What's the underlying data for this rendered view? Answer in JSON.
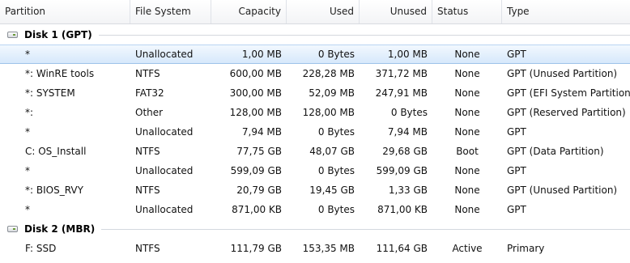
{
  "columns": {
    "partition": "Partition",
    "file_system": "File System",
    "capacity": "Capacity",
    "used": "Used",
    "unused": "Unused",
    "status": "Status",
    "type": "Type"
  },
  "disks": [
    {
      "label": "Disk 1 (GPT)",
      "rows": [
        {
          "partition": "*",
          "fs": "Unallocated",
          "capacity": "1,00 MB",
          "used": "0 Bytes",
          "unused": "1,00 MB",
          "status": "None",
          "type": "GPT",
          "selected": true
        },
        {
          "partition": "*: WinRE tools",
          "fs": "NTFS",
          "capacity": "600,00 MB",
          "used": "228,28 MB",
          "unused": "371,72 MB",
          "status": "None",
          "type": "GPT (Unused Partition)"
        },
        {
          "partition": "*: SYSTEM",
          "fs": "FAT32",
          "capacity": "300,00 MB",
          "used": "52,09 MB",
          "unused": "247,91 MB",
          "status": "None",
          "type": "GPT (EFI System Partition)"
        },
        {
          "partition": "*:",
          "fs": "Other",
          "capacity": "128,00 MB",
          "used": "128,00 MB",
          "unused": "0 Bytes",
          "status": "None",
          "type": "GPT (Reserved Partition)"
        },
        {
          "partition": "*",
          "fs": "Unallocated",
          "capacity": "7,94 MB",
          "used": "0 Bytes",
          "unused": "7,94 MB",
          "status": "None",
          "type": "GPT"
        },
        {
          "partition": "C: OS_Install",
          "fs": "NTFS",
          "capacity": "77,75 GB",
          "used": "48,07 GB",
          "unused": "29,68 GB",
          "status": "Boot",
          "type": "GPT (Data Partition)"
        },
        {
          "partition": "*",
          "fs": "Unallocated",
          "capacity": "599,09 GB",
          "used": "0 Bytes",
          "unused": "599,09 GB",
          "status": "None",
          "type": "GPT"
        },
        {
          "partition": "*: BIOS_RVY",
          "fs": "NTFS",
          "capacity": "20,79 GB",
          "used": "19,45 GB",
          "unused": "1,33 GB",
          "status": "None",
          "type": "GPT (Unused Partition)"
        },
        {
          "partition": "*",
          "fs": "Unallocated",
          "capacity": "871,00 KB",
          "used": "0 Bytes",
          "unused": "871,00 KB",
          "status": "None",
          "type": "GPT"
        }
      ]
    },
    {
      "label": "Disk 2 (MBR)",
      "rows": [
        {
          "partition": "F: SSD",
          "fs": "NTFS",
          "capacity": "111,79 GB",
          "used": "153,35 MB",
          "unused": "111,64 GB",
          "status": "Active",
          "type": "Primary"
        }
      ]
    }
  ]
}
